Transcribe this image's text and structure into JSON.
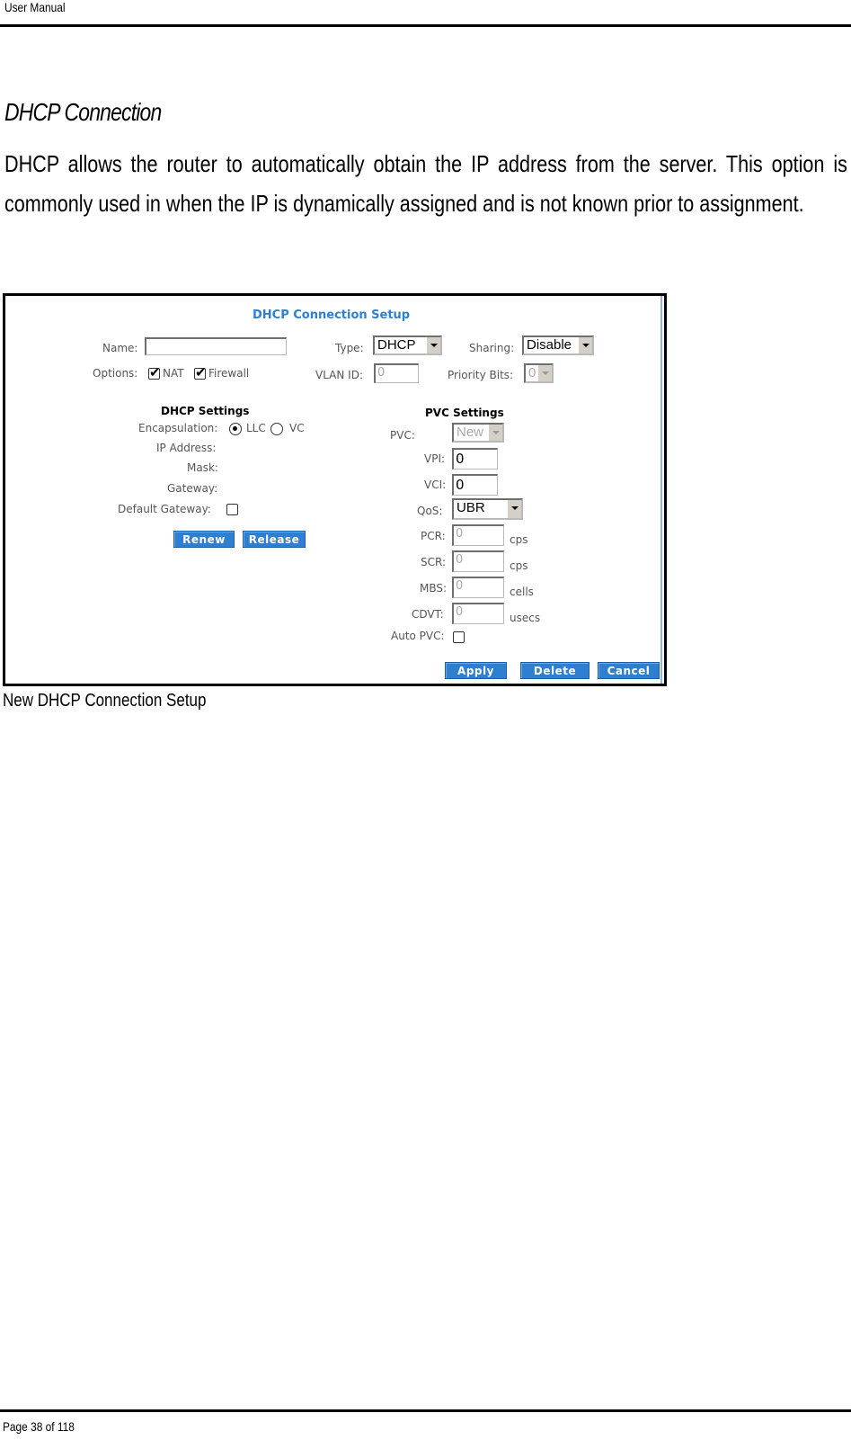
{
  "header": {
    "running_title": "User Manual"
  },
  "section": {
    "title": "DHCP Connection",
    "body": "DHCP allows the router to automatically obtain the IP address from the server. This option is commonly used in when the IP is dynamically assigned and is not known prior to assignment."
  },
  "figure": {
    "caption": "New DHCP Connection Setup",
    "ui": {
      "title": "DHCP Connection Setup",
      "name": {
        "label": "Name:",
        "value": ""
      },
      "type": {
        "label": "Type:",
        "value": "DHCP"
      },
      "sharing": {
        "label": "Sharing:",
        "value": "Disable"
      },
      "options": {
        "label": "Options:",
        "nat": {
          "label": "NAT",
          "checked": true
        },
        "firewall": {
          "label": "Firewall",
          "checked": true
        }
      },
      "vlan_id": {
        "label": "VLAN ID:",
        "value": "0"
      },
      "priority_bits": {
        "label": "Priority Bits:",
        "value": "0"
      },
      "dhcp_settings": {
        "heading": "DHCP Settings",
        "encapsulation": {
          "label": "Encapsulation:",
          "options": [
            "LLC",
            "VC"
          ],
          "selected": "LLC"
        },
        "ip_address": {
          "label": "IP Address:",
          "value": ""
        },
        "mask": {
          "label": "Mask:",
          "value": ""
        },
        "gateway": {
          "label": "Gateway:",
          "value": ""
        },
        "default_gateway": {
          "label": "Default Gateway:",
          "checked": false
        },
        "renew_label": "Renew",
        "release_label": "Release"
      },
      "pvc_settings": {
        "heading": "PVC Settings",
        "pvc": {
          "label": "PVC:",
          "value": "New"
        },
        "vpi": {
          "label": "VPI:",
          "value": "0"
        },
        "vci": {
          "label": "VCI:",
          "value": "0"
        },
        "qos": {
          "label": "QoS:",
          "value": "UBR"
        },
        "pcr": {
          "label": "PCR:",
          "value": "0",
          "unit": "cps"
        },
        "scr": {
          "label": "SCR:",
          "value": "0",
          "unit": "cps"
        },
        "mbs": {
          "label": "MBS:",
          "value": "0",
          "unit": "cells"
        },
        "cdvt": {
          "label": "CDVT:",
          "value": "0",
          "unit": "usecs"
        },
        "auto_pvc": {
          "label": "Auto PVC:",
          "checked": false
        }
      },
      "apply_label": "Apply",
      "delete_label": "Delete",
      "cancel_label": "Cancel",
      "accent_color": "#2f7fd0"
    }
  },
  "footer": {
    "page_label": "Page 38 of 118"
  }
}
